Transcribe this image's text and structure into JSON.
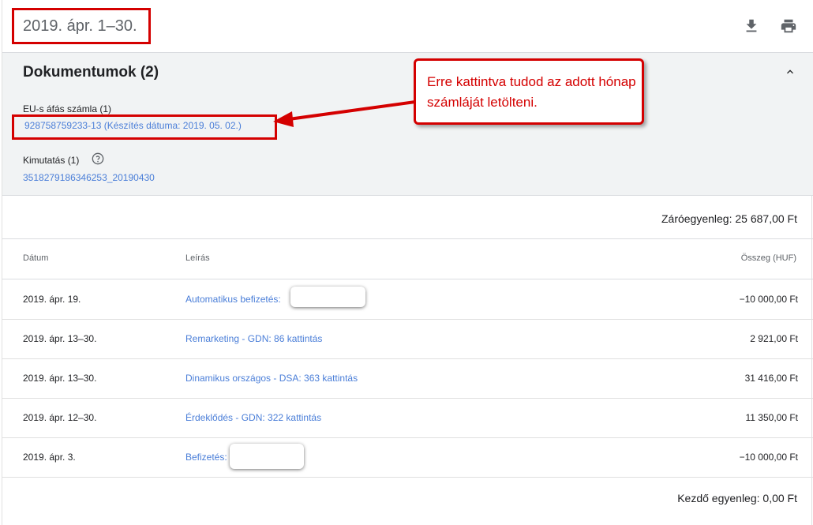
{
  "header": {
    "date_range": "2019. ápr. 1–30.",
    "download_icon": "download-icon",
    "print_icon": "print-icon"
  },
  "documents": {
    "title": "Dokumentumok (2)",
    "collapse_icon": "chevron-up-icon",
    "invoice_section": "EU-s áfás számla (1)",
    "invoice_link": "928758759233-13 (Készítés dátuma: 2019. 05. 02.)",
    "statement_section": "Kimutatás (1)",
    "help_icon": "help-circle-icon",
    "statement_link": "3518279186346253_20190430"
  },
  "annotation": {
    "text": "Erre kattintva tudod az adott hónap számláját letölteni."
  },
  "closing_balance": "Záróegyenleg: 25 687,00 Ft",
  "table": {
    "columns": [
      "Dátum",
      "Leírás",
      "Összeg (HUF)"
    ],
    "rows": [
      {
        "date": "2019. ápr. 19.",
        "description": "Automatikus befizetés:",
        "amount": "−10 000,00 Ft"
      },
      {
        "date": "2019. ápr. 13–30.",
        "description": "Remarketing - GDN: 86 kattintás",
        "amount": "2 921,00 Ft"
      },
      {
        "date": "2019. ápr. 13–30.",
        "description": "Dinamikus országos - DSA: 363 kattintás",
        "amount": "31 416,00 Ft"
      },
      {
        "date": "2019. ápr. 12–30.",
        "description": "Érdeklődés - GDN: 322 kattintás",
        "amount": "11 350,00 Ft"
      },
      {
        "date": "2019. ápr. 3.",
        "description": "Befizetés:",
        "amount": "−10 000,00 Ft"
      }
    ]
  },
  "opening_balance": "Kezdő egyenleg: 0,00 Ft",
  "colors": {
    "link": "#4a7ed8",
    "annotation_red": "#d40000",
    "panel_bg": "#f1f3f4"
  }
}
